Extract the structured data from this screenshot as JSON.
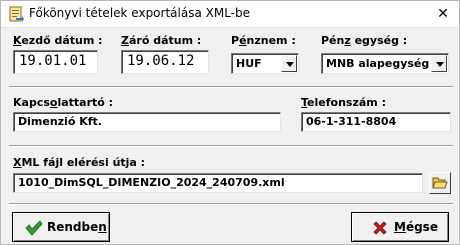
{
  "window": {
    "title": "Főkönyvi tételek exportálása XML-be",
    "close_symbol": "✕",
    "app_icon": "export-app-icon"
  },
  "fields": {
    "start_date": {
      "label_underlined": "K",
      "label_rest": "ezdő dátum :",
      "value": "19.01.01"
    },
    "end_date": {
      "label_underlined": "Z",
      "label_rest": "áró dátum :",
      "value": "19.06.12"
    },
    "currency": {
      "label_before": "P",
      "label_underlined": "é",
      "label_after": "nznem :",
      "value": "HUF"
    },
    "currency_unit": {
      "label_before": "Pén",
      "label_underlined": "z",
      "label_after": " egység :",
      "value": "MNB alapegység"
    },
    "contact": {
      "label_before": "Kapcs",
      "label_underlined": "o",
      "label_after": "lattartó :",
      "value": "Dimenzió Kft."
    },
    "phone": {
      "label_underlined": "T",
      "label_rest": "elefonszám :",
      "value": "06-1-311-8804"
    },
    "xml_path": {
      "label_underlined": "X",
      "label_rest": "ML fájl elérési útja :",
      "value": "1010_DimSQL_DIMENZIO_2024_240709.xml"
    }
  },
  "buttons": {
    "ok": {
      "label_before": "Rendbe",
      "label_underlined": "n",
      "label_after": "",
      "icon": "checkmark-icon"
    },
    "cancel": {
      "label_before": "",
      "label_underlined": "M",
      "label_after": "égse",
      "icon": "cross-icon"
    },
    "browse": {
      "icon": "open-folder-icon"
    }
  },
  "colors": {
    "check": "#2e9e2e",
    "cross": "#c81e1e",
    "folder": "#e8c04a"
  }
}
